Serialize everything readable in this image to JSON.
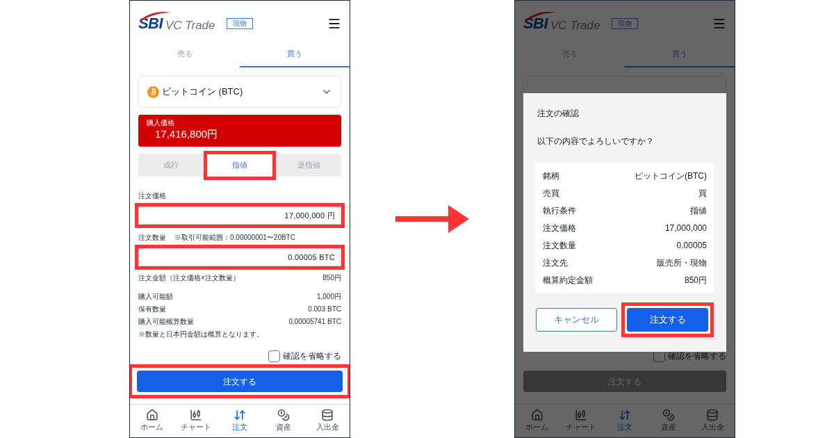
{
  "order_screen": {
    "header": {
      "brand": "SBI",
      "product": "VC Trade",
      "badge": "現物"
    },
    "tabs": [
      {
        "label": "売る",
        "selected": false
      },
      {
        "label": "買う",
        "selected": true
      }
    ],
    "coin_select": {
      "label": "ビットコイン (BTC)"
    },
    "price_banner": {
      "label": "購入価格",
      "value": "17,416,800円"
    },
    "order_types": [
      {
        "label": "成行",
        "selected": false,
        "highlighted": false
      },
      {
        "label": "指値",
        "selected": true,
        "highlighted": true
      },
      {
        "label": "逆指値",
        "selected": false,
        "highlighted": false
      }
    ],
    "price_field": {
      "label": "注文価格",
      "value": "17,000,000 円",
      "highlighted": true
    },
    "quantity_field": {
      "label": "注文数量",
      "hint": "※取引可能範囲：0.00000001〜20BTC",
      "value": "0.00005 BTC",
      "highlighted": true
    },
    "amount": {
      "label": "注文金額（注文価格×注文数量）",
      "value": "850円"
    },
    "info_rows": [
      {
        "label": "購入可能額",
        "value": "1,000円"
      },
      {
        "label": "保有数量",
        "value": "0.003 BTC"
      },
      {
        "label": "購入可能概算数量",
        "value": "0.00005741 BTC"
      }
    ],
    "note": "※数量と日本円金額は概算となります。",
    "skip_confirm": {
      "label": "確認を省略する",
      "checked": false
    },
    "submit": {
      "label": "注文する",
      "highlighted": true,
      "disabled": false
    },
    "nav": [
      {
        "label": "ホーム",
        "selected": false
      },
      {
        "label": "チャート",
        "selected": false
      },
      {
        "label": "注文",
        "selected": true
      },
      {
        "label": "資産",
        "selected": false
      },
      {
        "label": "入出金",
        "selected": false
      }
    ]
  },
  "confirm_screen": {
    "header": {
      "brand": "SBI",
      "product": "VC Trade",
      "badge": "現物"
    },
    "tabs": [
      {
        "label": "売る",
        "selected": false
      },
      {
        "label": "買う",
        "selected": true
      }
    ],
    "skip_confirm": {
      "label": "確認を省略する",
      "checked": false
    },
    "submit": {
      "label": "注文する",
      "highlighted": false,
      "disabled": true
    },
    "nav": [
      {
        "label": "ホーム",
        "selected": false
      },
      {
        "label": "チャート",
        "selected": false
      },
      {
        "label": "注文",
        "selected": true
      },
      {
        "label": "資産",
        "selected": false
      },
      {
        "label": "入出金",
        "selected": false
      }
    ],
    "dialog": {
      "title": "注文の確認",
      "message": "以下の内容でよろしいですか？",
      "rows": [
        {
          "label": "銘柄",
          "value": "ビットコイン(BTC)"
        },
        {
          "label": "売買",
          "value": "買"
        },
        {
          "label": "執行条件",
          "value": "指値"
        },
        {
          "label": "注文価格",
          "value": "17,000,000"
        },
        {
          "label": "注文数量",
          "value": "0.00005"
        },
        {
          "label": "注文先",
          "value": "販売所・現物"
        },
        {
          "label": "概算約定金額",
          "value": "850円"
        }
      ],
      "buttons": [
        {
          "label": "キャンセル",
          "kind": "secondary",
          "highlighted": false
        },
        {
          "label": "注文する",
          "kind": "primary",
          "highlighted": true
        }
      ]
    }
  }
}
